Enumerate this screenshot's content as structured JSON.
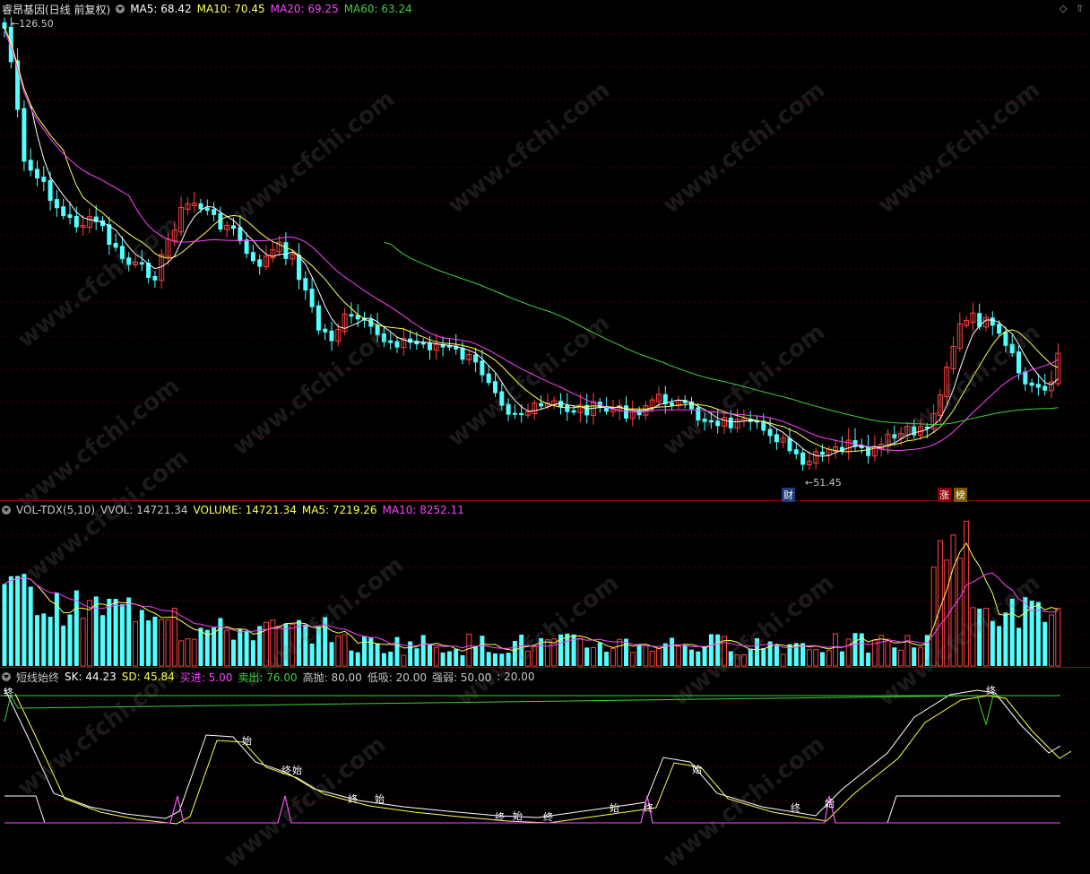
{
  "price_panel": {
    "title": "睿昂基因(日线 前复权)",
    "ma5": "MA5: 68.42",
    "ma10": "MA10: 70.45",
    "ma20": "MA20: 69.25",
    "ma60": "MA60: 63.24",
    "high_label": "126.50",
    "low_label": "51.45",
    "event_tags": [
      "财",
      "涨",
      "榜"
    ],
    "colors": {
      "up": "#ff4040",
      "down": "#54ffff",
      "ma5": "#ffffff",
      "ma10": "#ffff50",
      "ma20": "#ff40ff",
      "ma60": "#3cd23c"
    }
  },
  "volume_panel": {
    "name": "VOL-TDX(5,10)",
    "vvol": "VVOL: 14721.34",
    "volume": "VOLUME: 14721.34",
    "ma5": "MA5: 7219.26",
    "ma10": "MA10: 8252.11"
  },
  "indicator_panel": {
    "name": "短线始终",
    "sk": "SK: 44.23",
    "sd": "SD: 45.84",
    "buy": "买进: 5.00",
    "sell": "卖出: 76.00",
    "high_throw": "高抛: 80.00",
    "low_suck": "低吸: 20.00",
    "strength": "强弱: 50.00",
    "extra": ": 20.00",
    "markers": [
      "终",
      "始",
      "终",
      "始",
      "终",
      "始",
      "终",
      "始",
      "终",
      "始",
      "终",
      "始",
      "终",
      "始",
      "终"
    ]
  },
  "watermark": "www.cfchi.com",
  "window_controls": [
    "diamond-icon",
    "up-icon"
  ]
}
